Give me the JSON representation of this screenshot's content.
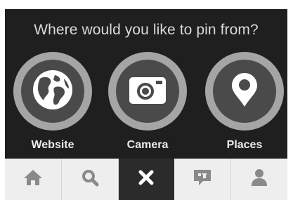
{
  "prompt": "Where would you like to pin from?",
  "options": [
    {
      "label": "Website",
      "icon": "globe-icon"
    },
    {
      "label": "Camera",
      "icon": "camera-icon"
    },
    {
      "label": "Places",
      "icon": "map-pin-icon"
    }
  ],
  "tabbar": {
    "active_tab": "close",
    "tabs": [
      {
        "id": "home",
        "icon": "home-icon"
      },
      {
        "id": "search",
        "icon": "search-icon"
      },
      {
        "id": "close",
        "icon": "close-icon"
      },
      {
        "id": "news",
        "icon": "speech-bubble-icon"
      },
      {
        "id": "profile",
        "icon": "person-icon"
      }
    ]
  },
  "colors": {
    "background": "#1f1f1f",
    "ring": "#a5a5a5",
    "ring_inner": "#4a4a4a",
    "icon": "#ffffff",
    "tabbar": "#eeeeee",
    "tab_icon": "#8a8a8a",
    "tab_active": "#2b2b2b"
  }
}
